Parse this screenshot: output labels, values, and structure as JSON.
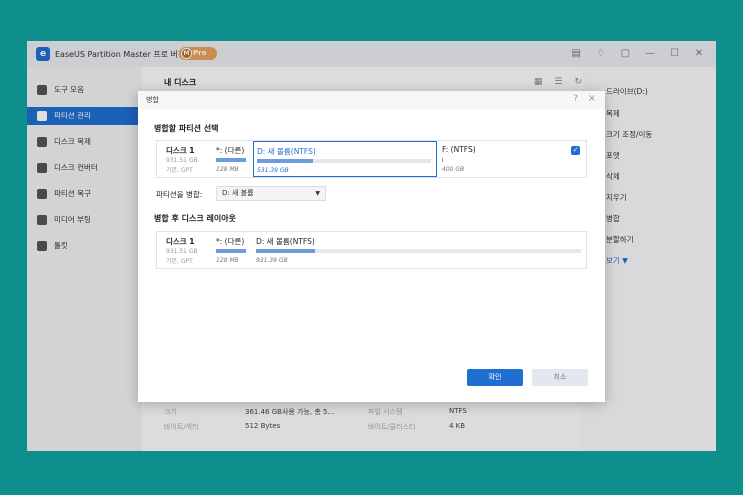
{
  "app": {
    "title": "EaseUS Partition Master 프로 버전",
    "logo_text": "e",
    "pro_badge_m": "M",
    "pro_badge": "Pro"
  },
  "titlebar_icons": [
    "notes-icon",
    "bell-icon",
    "window-icon",
    "minimize-icon",
    "maximize-icon",
    "close-icon"
  ],
  "sidebar": {
    "items": [
      {
        "label": "도구 모음",
        "icon": "toolbox-icon"
      },
      {
        "label": "파티션 관리",
        "icon": "pie-icon",
        "active": true
      },
      {
        "label": "디스크 복제",
        "icon": "clone-icon"
      },
      {
        "label": "디스크 컨버터",
        "icon": "convert-icon"
      },
      {
        "label": "파티션 복구",
        "icon": "recover-icon"
      },
      {
        "label": "미디어 부팅",
        "icon": "boot-icon"
      },
      {
        "label": "툴킷",
        "icon": "toolkit-icon"
      }
    ]
  },
  "main": {
    "header": "내 디스크",
    "properties": [
      {
        "label": "크기",
        "value": "361.46 GB사용 가능, 총 5..."
      },
      {
        "label": "파일 시스템",
        "value": "NTFS"
      },
      {
        "label": "바이트/섹터",
        "value": "512 Bytes"
      },
      {
        "label": "바이트/클러스터",
        "value": "4 KB"
      }
    ]
  },
  "right_panel": {
    "items": [
      "드라이브(D:)",
      "복제",
      "크기 조정/이동",
      "포맷",
      "삭제",
      "지우기",
      "병합",
      "분할하기",
      "보기 ▼"
    ]
  },
  "dialog": {
    "title": "병합",
    "help": "?",
    "close": "×",
    "section_select": "병합할 파티션 선택",
    "section_layout": "병합 후 디스크 레이아웃",
    "merge_into_label": "파티션을 병합:",
    "merge_into_value": "D: 새 볼륨",
    "disk_top": {
      "name": "디스크 1",
      "size": "931.51 GB",
      "type": "기본, GPT",
      "partitions": [
        {
          "label": "*: (다른)",
          "size": "128 MB",
          "fill": 100
        },
        {
          "label": "D: 새 볼륨(NTFS)",
          "size": "531.39 GB",
          "fill": 32,
          "selected": true
        },
        {
          "label": "F: (NTFS)",
          "size": "400 GB",
          "fill": 1,
          "checked": true
        }
      ]
    },
    "disk_bottom": {
      "name": "디스크 1",
      "size": "931.51 GB",
      "type": "기본, GPT",
      "partitions": [
        {
          "label": "*: (다른)",
          "size": "128 MB",
          "fill": 100
        },
        {
          "label": "D: 새 볼륨(NTFS)",
          "size": "931.39 GB",
          "fill": 18
        }
      ]
    },
    "ok_label": "확인",
    "cancel_label": "취소"
  }
}
